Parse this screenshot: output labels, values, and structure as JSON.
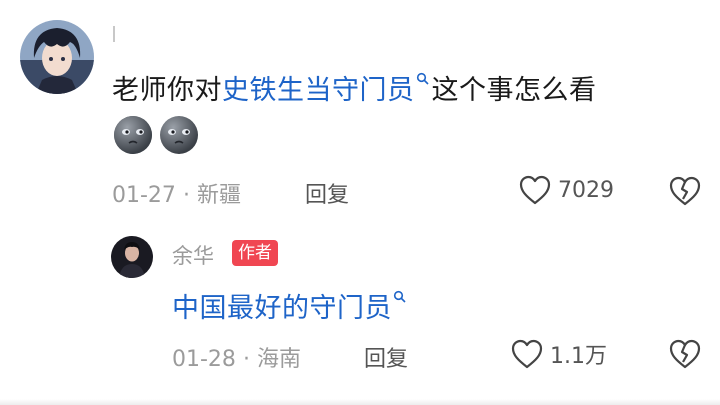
{
  "comment": {
    "avatar_icon": "anime-character-avatar",
    "username": "|",
    "text_before": "老师你对",
    "link_text": "史铁生当守门员",
    "text_after": "这个事怎么看",
    "emoji_icons": [
      "moon-face-emoji",
      "moon-face-emoji"
    ],
    "date": "01-27",
    "separator": "·",
    "location": "新疆",
    "reply_label": "回复",
    "like_icon": "heart-outline-icon",
    "like_count": "7029",
    "dislike_icon": "broken-heart-icon"
  },
  "reply": {
    "avatar_icon": "author-avatar",
    "username": "余华",
    "badge": "作者",
    "link_text": "中国最好的守门员",
    "date": "01-28",
    "separator": "·",
    "location": "海南",
    "reply_label": "回复",
    "like_icon": "heart-outline-icon",
    "like_count": "1.1万",
    "dislike_icon": "broken-heart-icon"
  },
  "colors": {
    "link_blue": "#1e64c8",
    "badge_red": "#f04652",
    "meta_gray": "#9b9b9b"
  }
}
